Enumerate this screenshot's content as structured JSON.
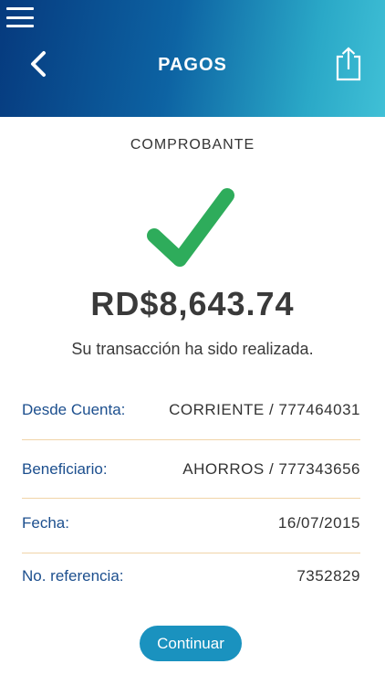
{
  "colors": {
    "header_gradient_start": "#063a7e",
    "header_gradient_end": "#40c0d6",
    "label": "#1c4f8e",
    "divider": "#f1d4a8",
    "check": "#2eac5b",
    "button": "#1a92bf"
  },
  "header": {
    "menu_icon": "hamburger-menu-icon",
    "back_icon": "chevron-left-icon",
    "title": "PAGOS",
    "share_icon": "share-icon"
  },
  "receipt": {
    "section_title": "COMPROBANTE",
    "status_icon": "checkmark-icon",
    "amount": "RD$8,643.74",
    "message": "Su transacción ha sido realizada.",
    "details": [
      {
        "label": "Desde Cuenta:",
        "value": "CORRIENTE / 777464031"
      },
      {
        "label": "Beneficiario:",
        "value": "AHORROS / 777343656"
      },
      {
        "label": "Fecha:",
        "value": "16/07/2015"
      },
      {
        "label": "No. referencia:",
        "value": "7352829"
      }
    ]
  },
  "actions": {
    "continue_label": "Continuar"
  }
}
